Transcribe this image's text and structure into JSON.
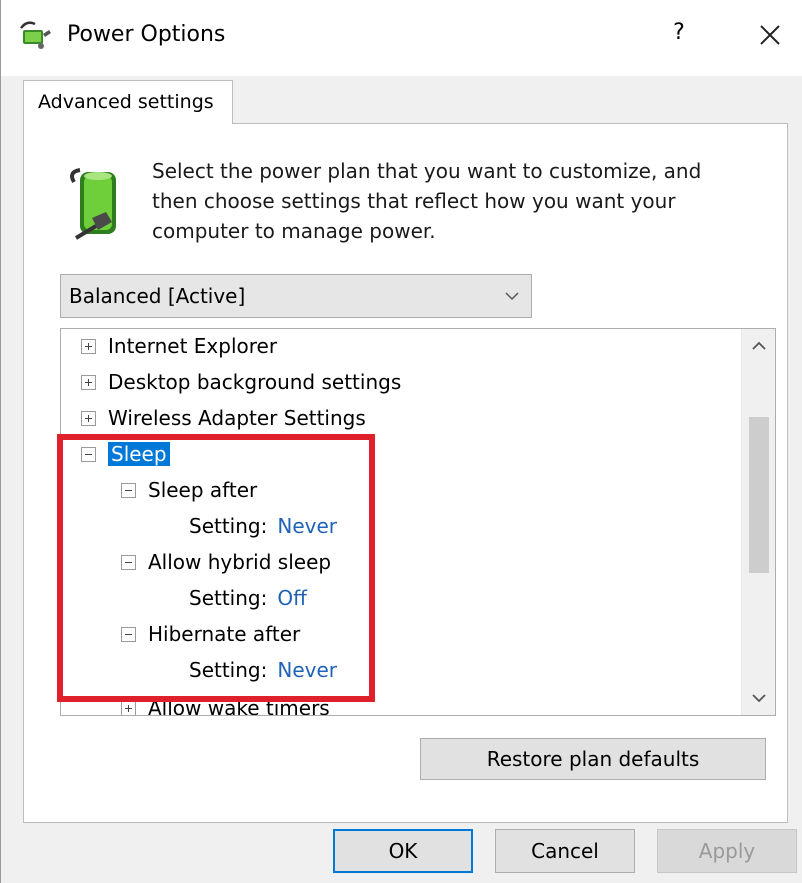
{
  "window": {
    "title": "Power Options",
    "help_glyph": "?",
    "close_glyph": "✕"
  },
  "tab": {
    "label": "Advanced settings"
  },
  "intro_text": "Select the power plan that you want to customize, and then choose settings that reflect how you want your computer to manage power.",
  "plan_select": {
    "selected": "Balanced [Active]"
  },
  "tree": {
    "items": [
      {
        "label": "Internet Explorer",
        "state": "collapsed"
      },
      {
        "label": "Desktop background settings",
        "state": "collapsed"
      },
      {
        "label": "Wireless Adapter Settings",
        "state": "collapsed"
      },
      {
        "label": "Sleep",
        "state": "expanded",
        "selected": true
      },
      {
        "label": "Sleep after",
        "state": "expanded"
      },
      {
        "setting_label": "Setting:",
        "value": "Never"
      },
      {
        "label": "Allow hybrid sleep",
        "state": "expanded"
      },
      {
        "setting_label": "Setting:",
        "value": "Off"
      },
      {
        "label": "Hibernate after",
        "state": "expanded"
      },
      {
        "setting_label": "Setting:",
        "value": "Never"
      },
      {
        "label": "Allow wake timers",
        "state": "collapsed"
      }
    ]
  },
  "buttons": {
    "restore": "Restore plan defaults",
    "ok": "OK",
    "cancel": "Cancel",
    "apply": "Apply"
  },
  "colors": {
    "accent": "#0078d7",
    "setting_value": "#1f63b5",
    "highlight_box": "#e0202a"
  }
}
